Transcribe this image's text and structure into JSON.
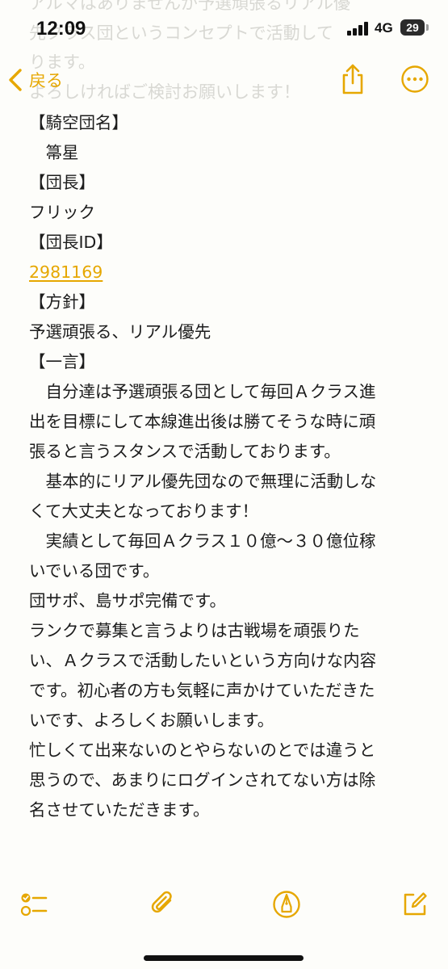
{
  "status_bar": {
    "time": "12:09",
    "network": "4G",
    "battery_level": "29"
  },
  "background_text": [
    "アルマはありませんが予選頑張るリアル優",
    "先クラス団というコンセプトで活動して",
    "ります。",
    "よろしければご検討お願いします！"
  ],
  "nav": {
    "back_label": "戻る",
    "back_icon": "chevron-left-icon",
    "share_icon": "share-icon",
    "more_icon": "ellipsis-circle-icon"
  },
  "note": {
    "lines": [
      "【騎空団名】",
      "　箒星",
      "【団長】",
      "フリック",
      "【団長ID】",
      "2981169",
      "【方針】",
      "予選頑張る、リアル優先",
      "【一言】",
      "　自分達は予選頑張る団として毎回Ａクラス進",
      "出を目標にして本線進出後は勝てそうな時に頑",
      "張ると言うスタンスで活動しております。",
      "　基本的にリアル優先団なので無理に活動しな",
      "くて大丈夫となっております！",
      "　実績として毎回Ａクラス１０億〜３０億位稼",
      "いでいる団です。",
      "団サポ、島サポ完備です。",
      "ランクで募集と言うよりは古戦場を頑張りた",
      "い、Ａクラスで活動したいという方向けな内容",
      "です。初心者の方も気軽に声かけていただきた",
      "いです、よろしくお願いします。",
      "忙しくて出来ないのとやらないのとでは違うと",
      "思うので、あまりにログインされてない方は除",
      "名させていただきます。"
    ]
  },
  "toolbar": {
    "checklist_icon": "checklist-icon",
    "attachment_icon": "paperclip-icon",
    "markup_icon": "markup-pen-icon",
    "compose_icon": "compose-icon"
  },
  "colors": {
    "accent": "#e6a700",
    "text": "#1c1c1c",
    "background": "#fdfdfa"
  }
}
